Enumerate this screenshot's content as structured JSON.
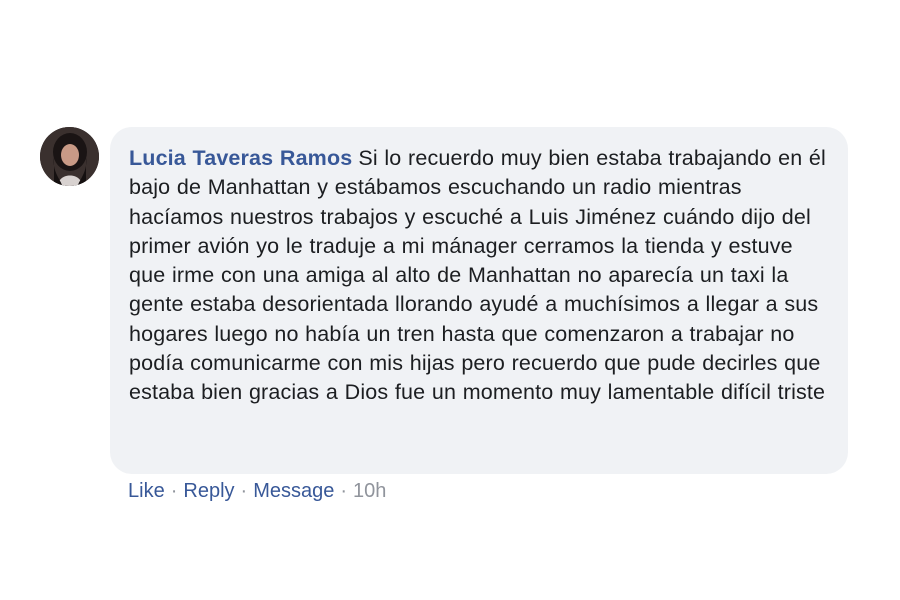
{
  "comment": {
    "author": "Lucia Taveras Ramos",
    "avatar_icon": "profile-photo",
    "body": "Si lo recuerdo muy bien estaba trabajando en él bajo de Manhattan y estábamos escuchando un radio mientras hacíamos nuestros trabajos y escuché a Luis Jiménez cuándo dijo del primer avión yo le traduje a mi mánager cerramos la tienda y estuve que irme con una amiga al alto de Manhattan no aparecía un taxi la gente estaba desorientada llorando ayudé a muchísimos a llegar a sus hogares luego no había un tren hasta que comenzaron a trabajar no podía comunicarme con mis hijas pero recuerdo que pude decirles que estaba bien gracias a Dios fue un momento muy lamentable difícil triste"
  },
  "actions": {
    "like_label": "Like",
    "reply_label": "Reply",
    "message_label": "Message",
    "separator": "·",
    "timestamp": "10h"
  },
  "colors": {
    "author": "#385898",
    "bubble": "#f0f2f5",
    "text": "#1c1e21",
    "meta": "#90949c"
  }
}
